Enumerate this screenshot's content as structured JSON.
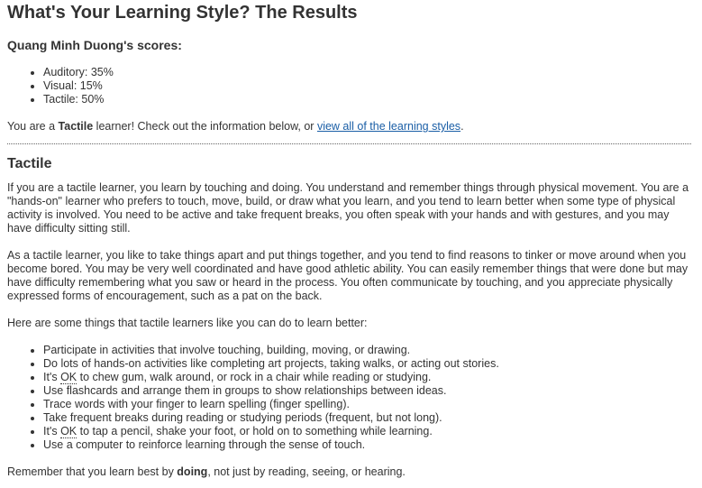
{
  "page_title": "What's Your Learning Style? The Results",
  "scores": {
    "heading": "Quang Minh Duong's scores:",
    "items": [
      {
        "label": "Auditory:",
        "value": "35%"
      },
      {
        "label": "Visual:",
        "value": "15%"
      },
      {
        "label": "Tactile:",
        "value": "50%"
      }
    ]
  },
  "result": {
    "prefix": "You are a ",
    "style": "Tactile",
    "middle": " learner! Check out the information below, or ",
    "link_text": "view all of the learning styles",
    "suffix": "."
  },
  "section": {
    "heading": "Tactile",
    "paragraph1": "If you are a tactile learner, you learn by touching and doing. You understand and remember things through physical movement. You are a \"hands-on\" learner who prefers to touch, move, build, or draw what you learn, and you tend to learn better when some type of physical activity is involved. You need to be active and take frequent breaks, you often speak with your hands and with gestures, and you may have difficulty sitting still.",
    "paragraph2": "As a tactile learner, you like to take things apart and put things together, and you tend to find reasons to tinker or move around when you become bored. You may be very well coordinated and have good athletic ability. You can easily remember things that were done but may have difficulty remembering what you saw or heard in the process. You often communicate by touching, and you appreciate physically expressed forms of encouragement, such as a pat on the back.",
    "paragraph3": "Here are some things that tactile learners like you can do to learn better:",
    "tips": {
      "tip1": "Participate in activities that involve touching, building, moving, or drawing.",
      "tip2": "Do lots of hands-on activities like completing art projects, taking walks, or acting out stories.",
      "tip3_before": "It's ",
      "tip3_ok": "OK",
      "tip3_after": " to chew gum, walk around, or rock in a chair while reading or studying.",
      "tip4": "Use flashcards and arrange them in groups to show relationships between ideas.",
      "tip5": "Trace words with your finger to learn spelling (finger spelling).",
      "tip6": "Take frequent breaks during reading or studying periods (frequent, but not long).",
      "tip7_before": "It's ",
      "tip7_ok": "OK",
      "tip7_after": " to tap a pencil, shake your foot, or hold on to something while learning.",
      "tip8": "Use a computer to reinforce learning through the sense of touch."
    },
    "closing": {
      "before": "Remember that you learn best by ",
      "emphasis": "doing",
      "after": ", not just by reading, seeing, or hearing."
    }
  }
}
